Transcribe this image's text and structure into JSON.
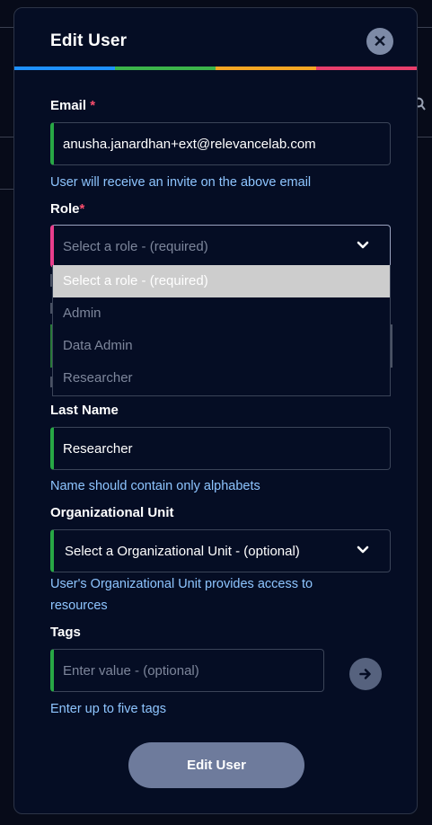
{
  "modal": {
    "title": "Edit User",
    "stripe_colors": [
      "#1e90ff",
      "#3cb44b",
      "#f5a623",
      "#e83e6c"
    ]
  },
  "email": {
    "label": "Email",
    "required_mark": "*",
    "value": "anusha.janardhan+ext@relevancelab.com",
    "hint": "User will receive an invite on the above email"
  },
  "role": {
    "label": "Role",
    "required_mark": "*",
    "selected": "Select a role - (required)",
    "options": [
      "Select a role - (required)",
      "Admin",
      "Data Admin",
      "Researcher"
    ]
  },
  "last_name": {
    "label": "Last Name",
    "value": "Researcher",
    "hint": "Name should contain only alphabets"
  },
  "org_unit": {
    "label": "Organizational Unit",
    "selected": "Select a Organizational Unit - (optional)",
    "hint": "User's Organizational Unit provides access to resources"
  },
  "tags": {
    "label": "Tags",
    "placeholder": "Enter value - (optional)",
    "hint": "Enter up to five tags"
  },
  "submit": {
    "label": "Edit User"
  },
  "icons": {
    "close": "close-icon",
    "chevron": "chevron-down-icon",
    "arrow": "arrow-right-icon",
    "search": "search-icon"
  }
}
